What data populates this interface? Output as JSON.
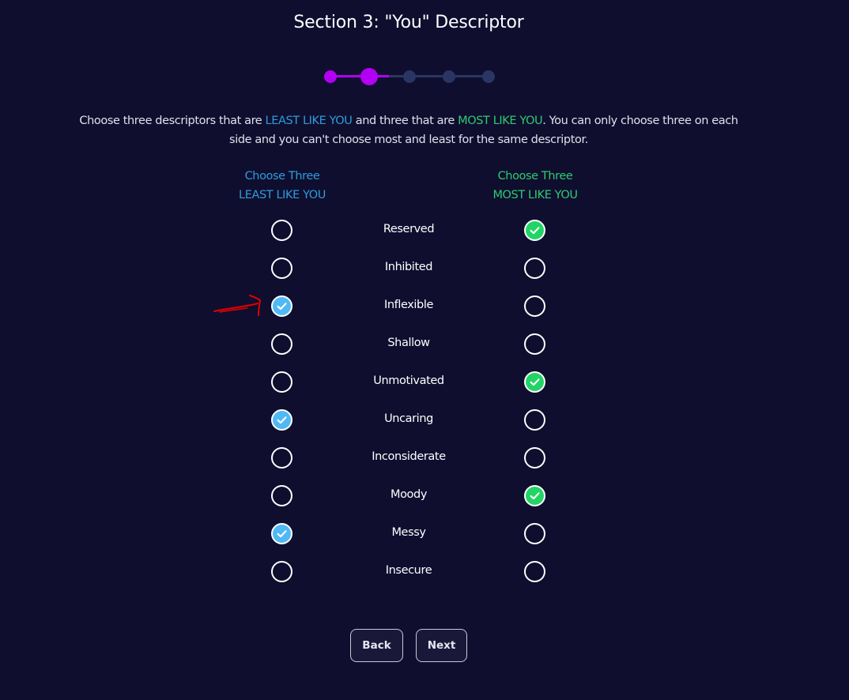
{
  "header": {
    "title": "Section 3: \"You\" Descriptor"
  },
  "progress": {
    "total_steps": 5,
    "current_step": 2,
    "completed_steps": 1,
    "colors": {
      "done": "#b300f5",
      "pending": "#2a3563"
    }
  },
  "instructions": {
    "part1": "Choose three descriptors that are ",
    "least_phrase": "LEAST LIKE YOU",
    "part2": " and three that are ",
    "most_phrase": "MOST LIKE YOU",
    "part3": ". You can only choose three on each side and you can't choose most and least for the same descriptor."
  },
  "columns": {
    "least": {
      "line1": "Choose Three",
      "line2": "LEAST LIKE YOU",
      "color": "#2e9cdb",
      "check_color": "#4fb9f5"
    },
    "most": {
      "line1": "Choose Three",
      "line2": "MOST LIKE YOU",
      "color": "#2ecc71",
      "check_color": "#22d466"
    }
  },
  "descriptors": [
    {
      "label": "Reserved",
      "least": false,
      "most": true
    },
    {
      "label": "Inhibited",
      "least": false,
      "most": false
    },
    {
      "label": "Inflexible",
      "least": true,
      "most": false
    },
    {
      "label": "Shallow",
      "least": false,
      "most": false
    },
    {
      "label": "Unmotivated",
      "least": false,
      "most": true
    },
    {
      "label": "Uncaring",
      "least": true,
      "most": false
    },
    {
      "label": "Inconsiderate",
      "least": false,
      "most": false
    },
    {
      "label": "Moody",
      "least": false,
      "most": true
    },
    {
      "label": "Messy",
      "least": true,
      "most": false
    },
    {
      "label": "Insecure",
      "least": false,
      "most": false
    }
  ],
  "annotation": {
    "icon": "red-arrow-icon",
    "points_to": "Inflexible",
    "color": "#e00000"
  },
  "buttons": {
    "back": "Back",
    "next": "Next"
  }
}
